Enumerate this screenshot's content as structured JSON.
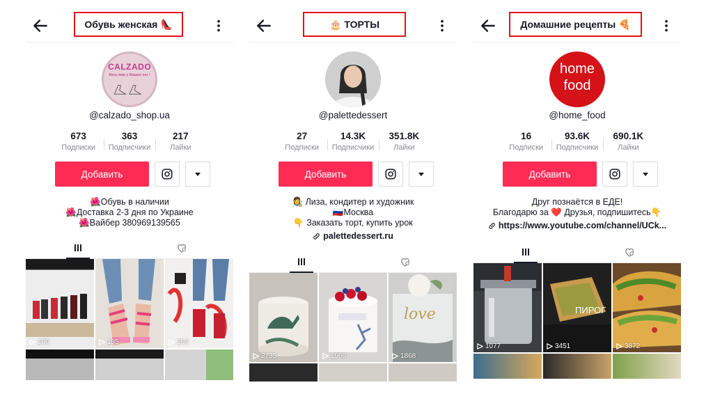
{
  "panels": [
    {
      "title": "Обувь женская 👠",
      "avatar_brand": "CALZADO",
      "avatar_tagline": "Весь мир у Ваших ног !",
      "handle": "@calzado_shop.ua",
      "stats": [
        {
          "num": "673",
          "label": "Подписки"
        },
        {
          "num": "363",
          "label": "Подписчики"
        },
        {
          "num": "217",
          "label": "Лайки"
        }
      ],
      "add_label": "Добавить",
      "bio": [
        "🌺Обувь в наличии",
        "🌺Доставка 2-3 дня по Украине",
        "🌺Вайбер 380969139565"
      ],
      "views": [
        "106",
        "185",
        "204"
      ]
    },
    {
      "title": "🎂 ТОРТЫ",
      "handle": "@palettedessert",
      "stats": [
        {
          "num": "27",
          "label": "Подписки"
        },
        {
          "num": "14.3K",
          "label": "Подписчики"
        },
        {
          "num": "351.8K",
          "label": "Лайки"
        }
      ],
      "add_label": "Добавить",
      "bio": [
        "👩‍🎨 Лиза, кондитер и художник",
        "🇷🇺Москва",
        "👇 Заказать торт, купить урок"
      ],
      "link": "palettedessert.ru",
      "cake_text": "love",
      "views": [
        "2735",
        "1969",
        "1868"
      ]
    },
    {
      "title": "Домашние рецепты 🍕",
      "avatar_word_top": "home",
      "avatar_word_bottom": "food",
      "handle": "@home_food",
      "stats": [
        {
          "num": "16",
          "label": "Подписки"
        },
        {
          "num": "93.6K",
          "label": "Подписчики"
        },
        {
          "num": "690.1K",
          "label": "Лайки"
        }
      ],
      "add_label": "Добавить",
      "bio": [
        "Друг познаётся в ЕДЕ!",
        "Благодарю за ❤️ Друзья, подпишитесь👇"
      ],
      "link": "https://www.youtube.com/channel/UCk...",
      "pie_caption": "ПИРОГ",
      "views": [
        "1077",
        "3451",
        "3872"
      ]
    }
  ],
  "colors": {
    "accent": "#fe2c55",
    "highlight_box": "#e3111b"
  }
}
